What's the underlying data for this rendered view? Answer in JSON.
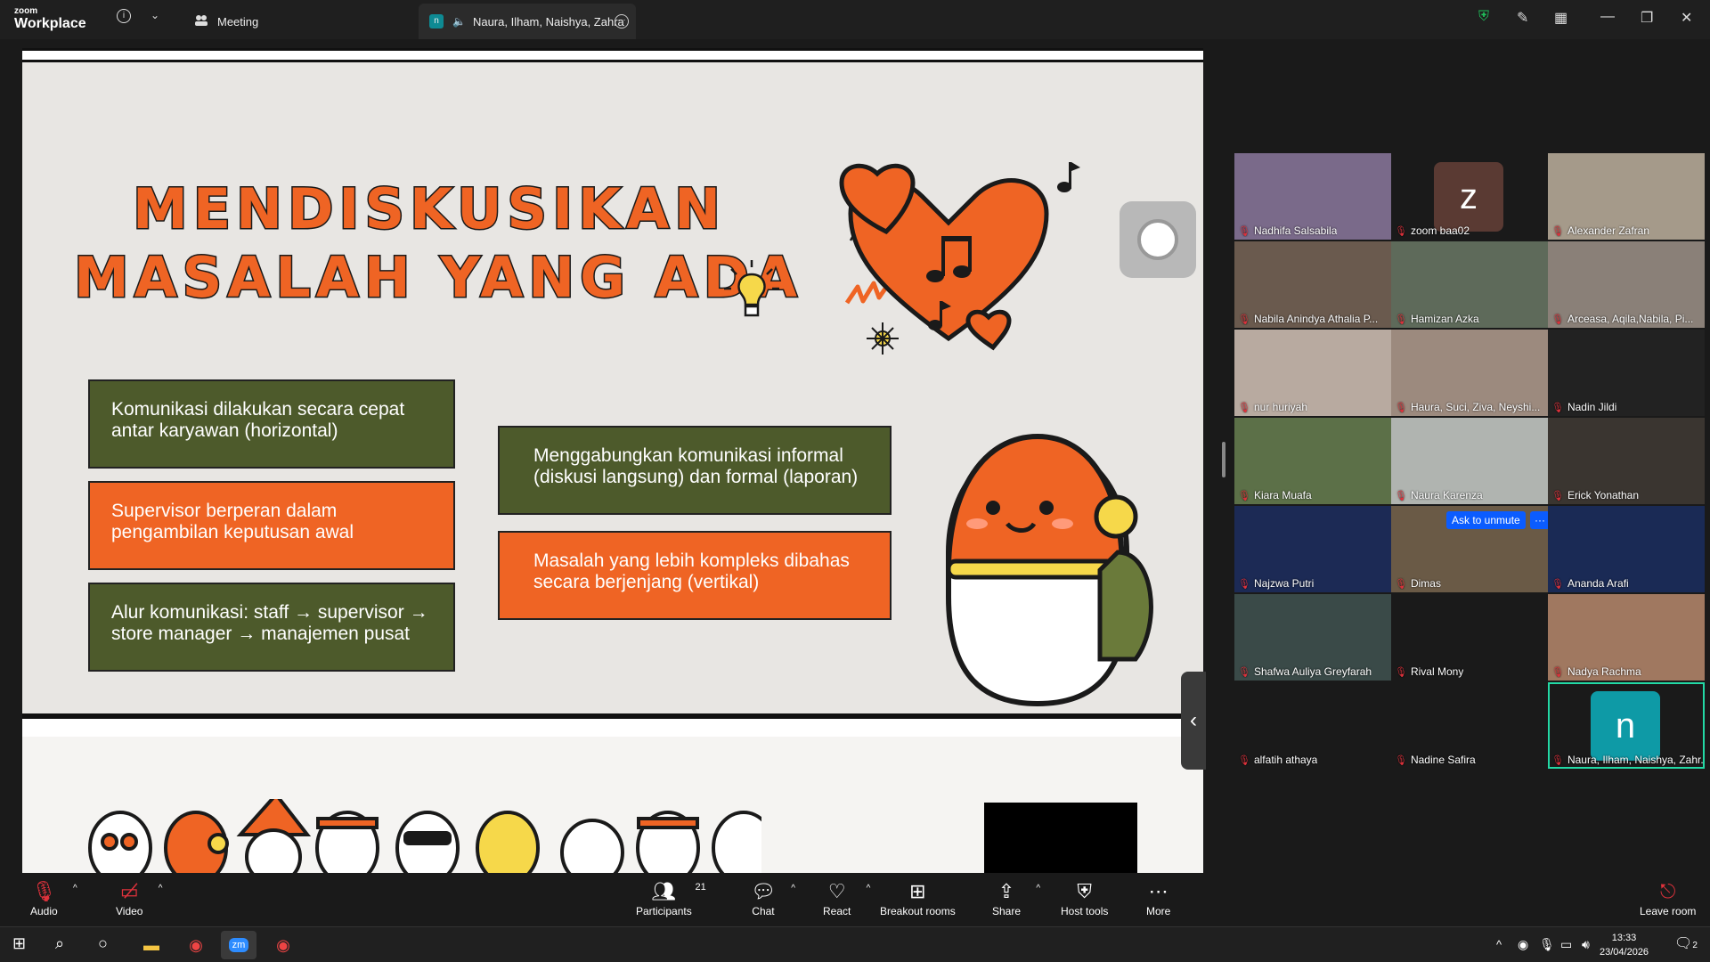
{
  "window": {
    "logo_small": "zoom",
    "logo_big": "Workplace",
    "tab_meeting": "Meeting",
    "tab_active": "Naura, Ilham, Naishya, Zahra",
    "tab_active_badge": "n"
  },
  "slide": {
    "title_line1": "MENDISKUSIKAN",
    "title_line2": "MASALAH YANG ADA",
    "boxes": [
      {
        "text": "Komunikasi dilakukan secara cepat antar karyawan (horizontal)",
        "color": "#4d5a2b"
      },
      {
        "text": "Supervisor berperan dalam pengambilan keputusan awal",
        "color": "#ef6424"
      },
      {
        "text": "Alur komunikasi: staff → supervisor → store manager → manajemen pusat",
        "color": "#4d5a2b"
      },
      {
        "text": "Menggabungkan komunikasi informal (diskusi langsung) dan formal (laporan)",
        "color": "#4d5a2b"
      },
      {
        "text": "Masalah yang lebih kompleks dibahas secara berjenjang (vertikal)",
        "color": "#ef6424"
      }
    ]
  },
  "participants": [
    {
      "name": "Nadhifa Salsabila",
      "bg": "#7a6a8a"
    },
    {
      "name": "zoom baa02",
      "bg": "#1a1a1a",
      "avatar": "z",
      "avatar_color": "#5a3a33"
    },
    {
      "name": "Alexander Zafran",
      "bg": "#a59a8a"
    },
    {
      "name": "Nabila Anindya Athalia P...",
      "bg": "#6a5a4e"
    },
    {
      "name": "Hamizan Azka",
      "bg": "#5e6a5a"
    },
    {
      "name": "Arceasa, Aqila,Nabila, Pi...",
      "bg": "#8a8078"
    },
    {
      "name": "nur huriyah",
      "bg": "#b8aaa0"
    },
    {
      "name": "Haura, Suci, Ziva, Neyshi...",
      "bg": "#9c8a7e"
    },
    {
      "name": "Nadin Jildi",
      "bg": "#222222"
    },
    {
      "name": "Kiara Muafa",
      "bg": "#5c7048"
    },
    {
      "name": "Naura Karenza",
      "bg": "#b0b4b0"
    },
    {
      "name": "Erick Yonathan",
      "bg": "#3a3530"
    },
    {
      "name": "Najzwa Putri",
      "bg": "#1c2a55"
    },
    {
      "name": "Dimas",
      "bg": "#6a5a46"
    },
    {
      "name": "Ananda Arafi",
      "bg": "#1a2a55"
    },
    {
      "name": "Shafwa Auliya Greyfarah",
      "bg": "#3a4a48"
    },
    {
      "name": "Rival Mony",
      "bg": "#1a1a1a"
    },
    {
      "name": "Nadya Rachma",
      "bg": "#a07860"
    },
    {
      "name": "alfatih athaya",
      "bg": "#1a1a1a"
    },
    {
      "name": "Nadine Safira",
      "bg": "#1a1a1a"
    },
    {
      "name": "Naura, Ilham, Naishya, Zahr...",
      "bg": "#1a1a1a",
      "avatar": "n",
      "avatar_color": "#0e9aa6"
    }
  ],
  "ask_unmute": "Ask to unmute",
  "ask_more": "···",
  "toolbar": {
    "audio": "Audio",
    "video": "Video",
    "participants": "Participants",
    "participants_count": "21",
    "chat": "Chat",
    "react": "React",
    "breakout": "Breakout rooms",
    "share": "Share",
    "host_tools": "Host tools",
    "more": "More",
    "leave": "Leave room"
  },
  "taskbar": {
    "time": "13:33",
    "date": "23/04/2026",
    "notif_count": "2"
  }
}
